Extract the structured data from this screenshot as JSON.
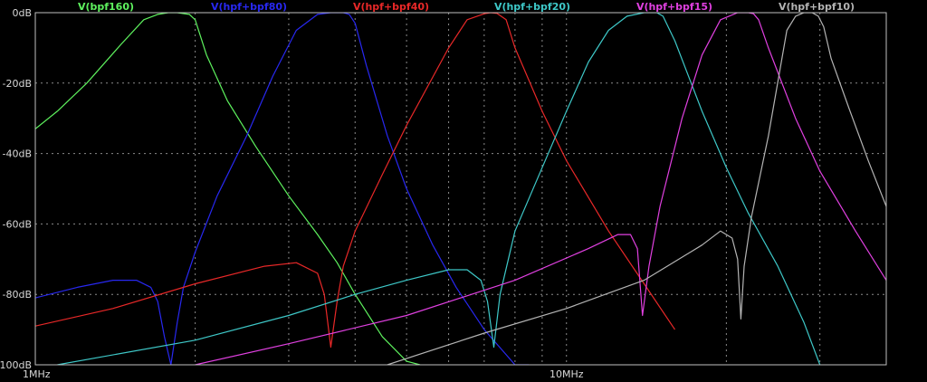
{
  "chart_data": {
    "type": "line",
    "x_scale": "log",
    "x_unit": "Hz",
    "xlim": [
      1000000,
      40000000
    ],
    "ylim": [
      -100,
      0
    ],
    "grid": true,
    "y_ticks": [
      {
        "value": 0,
        "label": "0dB"
      },
      {
        "value": -20,
        "label": "-20dB"
      },
      {
        "value": -40,
        "label": "-40dB"
      },
      {
        "value": -60,
        "label": "-60dB"
      },
      {
        "value": -80,
        "label": "-80dB"
      },
      {
        "value": -100,
        "label": "-100dB"
      }
    ],
    "x_ticks": [
      {
        "value": 1000000,
        "label": "1MHz"
      },
      {
        "value": 10000000,
        "label": "10MHz"
      }
    ],
    "series": [
      {
        "name": "V(bpf160)",
        "color": "#5ef25e",
        "x": [
          1000000,
          1100000,
          1250000,
          1450000,
          1600000,
          1700000,
          1780000,
          1850000,
          1950000,
          2000000,
          2100000,
          2300000,
          2600000,
          3000000,
          3400000,
          3700000,
          4000000,
          4500000,
          5000000,
          5300000
        ],
        "y": [
          -33,
          -28,
          -20,
          -9,
          -2,
          -0.5,
          0,
          0,
          -0.5,
          -2,
          -12,
          -25,
          -38,
          -52,
          -63,
          -71,
          -80,
          -92,
          -99,
          -100
        ]
      },
      {
        "name": "V(hpf+bpf80)",
        "color": "#2828f0",
        "x": [
          1000000,
          1200000,
          1400000,
          1550000,
          1650000,
          1700000,
          1750000,
          1800000,
          1850000,
          1900000,
          2000000,
          2200000,
          2500000,
          2800000,
          3100000,
          3400000,
          3600000,
          3800000,
          3900000,
          4000000,
          4200000,
          4600000,
          5000000,
          5600000,
          6200000,
          7000000,
          8000000,
          8500000
        ],
        "y": [
          -81,
          -78,
          -76,
          -76,
          -78,
          -82,
          -92,
          -100,
          -88,
          -78,
          -68,
          -52,
          -35,
          -18,
          -5,
          -0.5,
          0,
          0,
          -0.5,
          -3,
          -15,
          -35,
          -50,
          -66,
          -78,
          -90,
          -100,
          -100
        ]
      },
      {
        "name": "V(hpf+bpf40)",
        "color": "#e82828",
        "x": [
          1000000,
          1400000,
          2000000,
          2700000,
          3100000,
          3400000,
          3500000,
          3600000,
          3700000,
          3800000,
          4000000,
          4500000,
          5000000,
          6000000,
          6500000,
          7000000,
          7200000,
          7400000,
          7700000,
          8000000,
          9000000,
          10000000,
          12000000,
          14000000,
          16000000
        ],
        "y": [
          -89,
          -84,
          -77,
          -72,
          -71,
          -74,
          -80,
          -95,
          -82,
          -72,
          -62,
          -46,
          -32,
          -10,
          -2,
          -0.3,
          0,
          -0.2,
          -2,
          -10,
          -28,
          -42,
          -62,
          -77,
          -90
        ]
      },
      {
        "name": "V(hpf+bpf20)",
        "color": "#3ec8c8",
        "x": [
          1100000,
          2000000,
          3000000,
          4000000,
          5000000,
          6000000,
          6500000,
          6900000,
          7100000,
          7300000,
          7500000,
          8000000,
          9000000,
          10000000,
          11000000,
          12000000,
          13000000,
          14000000,
          14800000,
          15200000,
          16000000,
          18000000,
          20000000,
          22000000,
          25000000,
          28000000,
          30000000
        ],
        "y": [
          -100,
          -93,
          -86,
          -80,
          -76,
          -73,
          -73,
          -76,
          -82,
          -95,
          -80,
          -62,
          -44,
          -28,
          -14,
          -5,
          -1,
          0,
          0,
          -1,
          -8,
          -28,
          -44,
          -57,
          -72,
          -88,
          -100
        ]
      },
      {
        "name": "V(hpf+bpf15)",
        "color": "#e040e0",
        "x": [
          2000000,
          3000000,
          5000000,
          8000000,
          11000000,
          12500000,
          13200000,
          13600000,
          13900000,
          14300000,
          15000000,
          16500000,
          18000000,
          19500000,
          21000000,
          22000000,
          22500000,
          23000000,
          24000000,
          27000000,
          30000000,
          35000000,
          40000000
        ],
        "y": [
          -100,
          -94,
          -86,
          -76,
          -67,
          -63,
          -63,
          -67,
          -86,
          -72,
          -55,
          -30,
          -12,
          -2,
          0,
          0,
          -0.3,
          -2,
          -10,
          -30,
          -45,
          -62,
          -76
        ]
      },
      {
        "name": "V(hpf+bpf10)",
        "color": "#b4b4b4",
        "x": [
          4600000,
          7000000,
          10000000,
          14000000,
          18000000,
          19500000,
          20500000,
          21000000,
          21300000,
          21600000,
          22300000,
          24000000,
          26000000,
          27000000,
          28000000,
          29000000,
          29800000,
          30500000,
          31500000,
          34000000,
          37000000,
          40000000
        ],
        "y": [
          -100,
          -91,
          -84,
          -76,
          -66,
          -62,
          -64,
          -70,
          -87,
          -72,
          -58,
          -35,
          -5,
          -1,
          0,
          0,
          -1,
          -4,
          -13,
          -27,
          -42,
          -55
        ]
      }
    ]
  }
}
